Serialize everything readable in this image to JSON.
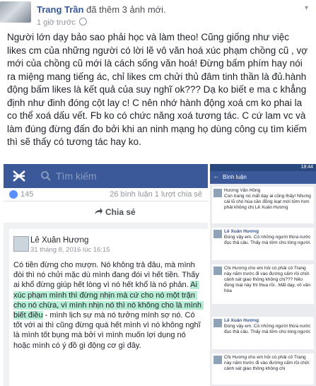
{
  "post": {
    "author": "Trang Trần",
    "action": "đã thêm 3 ảnh mới.",
    "time": "1 giờ trước",
    "text": "Người lớn dạy bảo sao phải học và làm theo! Cũng giống như việc likes cm của những người có lời lẽ vô văn hoá xúc phạm chồng cũ , vợ mới của chồng cũ mới là cách sống văn hoá! Đừng bấm phím hay nói ra miệng mang tiếng ác, chỉ likes cm chửi thủ đâm tinh thần là đủ.hành động bấm likes là kết quả của suy nghĩ ok??? Dạ ko biết e ma c khẳng định như đinh đóng cột lay c! C nên nhớ hành động xoá cm ko phai la co thể xoá dấu vết. Fb ko có chức năng xoá tương tác. C cứ lam vc và làm đúng đừng đấn đo bởi khi an ninh mạng họ dùng công cụ tìm kiếm thì sẽ thấy có tương tác hay ko."
  },
  "left_shot": {
    "search_placeholder": "Tìm kiếm",
    "reaction_count": "145",
    "reaction_right": "26 bình luận 1 lượt chia sẻ",
    "share_label": "Chia sẻ",
    "inner_author": "Lê Xuân Hương",
    "inner_time": "31 tháng 8, 2016 lúc 16:15",
    "inner_text_a": "Có tiền đừng cho mượn. Nó không trả đâu, mà mình đòi thì nó chửi mặc dù mình đang đói vì hết tiền. Thấy ai khổ đừng giúp hết lòng vì nó hết khổ là nó phản. ",
    "inner_text_hl1": "Ai xúc phạm mình thì đừng nhịn mà cứ cho nó một trận cho nó chừa, vì mình nhịn nó thì nó không cho là mình biết điều",
    "inner_text_b": " - mình lịch sự mà nó tưởng mình sợ nó. Có tốt với ai thì cũng đừng quá hết mình vì nó không nghĩ là mình tốt bụng mà bởi vì mình muốn lợi dụng nó hoặc mình có ý đồ gì động cơ gì đây."
  },
  "right_shot": {
    "status_time": "18:44",
    "header_title": "Bình luận",
    "comments": [
      {
        "name": "",
        "text": "Hương Vân Hồng\nCon trang nó mất dạy ai cũng thấy! Nhưng cái lũ chó hùa căn đồng loạt mới tởm hơn phải không chị Lê Xuân Hương",
        "time": ""
      },
      {
        "name": "Lê Xuân Hương",
        "text": "Đúng vậy em. Có những người thừa nước đục thả câu. Thấy mà tởm cho lòng người.",
        "time": ""
      },
      {
        "name": "",
        "text": "Chị Hương cho em hỏi có phải cô Trang này năm trước đi vào đường cấm rồi chửi cảnh sát giao thông không chị??? Nếu đúng loại này thì thua rồi.. Mất dạy, vô văn hóa",
        "time": ""
      },
      {
        "name": "Lê Xuân Hương",
        "text": "Đúng vậy em. Có những người thừa nước đục thả câu. Thấy mà tởm cho lòng người.",
        "time": ""
      },
      {
        "name": "",
        "text": "Chị Hương cho em hỏi có phải cô Trang này năm trước đi vào đường cấm rồi chửi cảnh sát giao thông không chị",
        "time": ""
      }
    ]
  }
}
